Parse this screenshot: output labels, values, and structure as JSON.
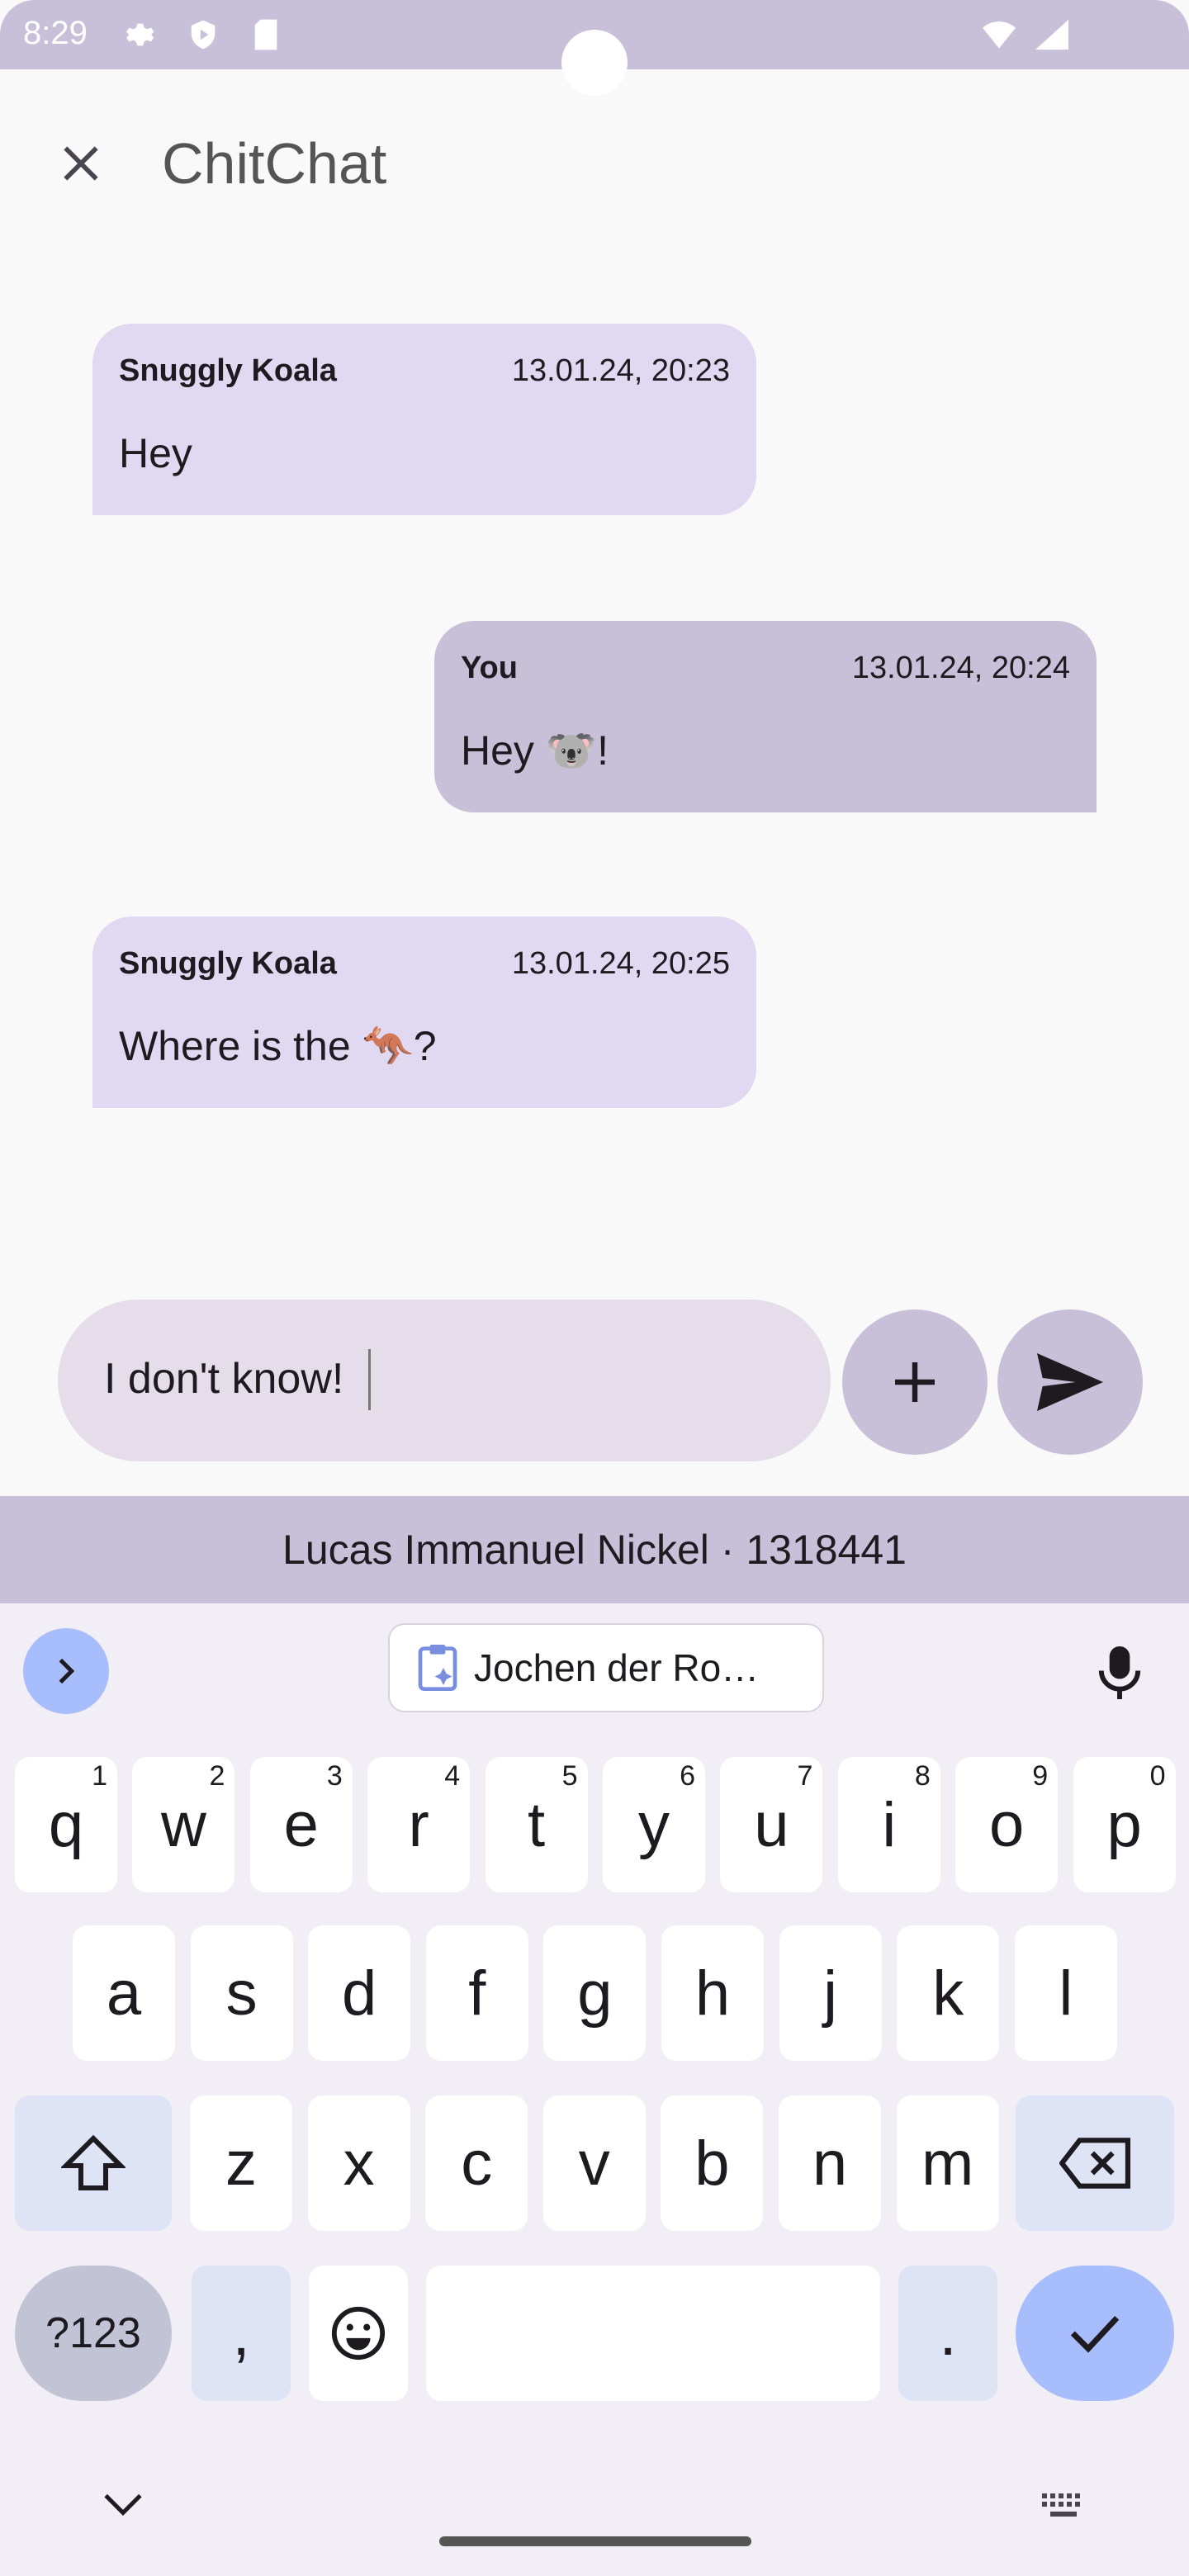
{
  "status_bar": {
    "time": "8:29",
    "icons": [
      "gear-icon",
      "shield-icon",
      "sd-card-icon",
      "wifi-icon",
      "signal-icon"
    ]
  },
  "app_bar": {
    "title": "ChitChat",
    "close_icon": "close-icon"
  },
  "messages": [
    {
      "sender": "Snuggly Koala",
      "timestamp": "13.01.24, 20:23",
      "text": "Hey",
      "outgoing": false
    },
    {
      "sender": "You",
      "timestamp": "13.01.24, 20:24",
      "text": "Hey 🐨!",
      "outgoing": true
    },
    {
      "sender": "Snuggly Koala",
      "timestamp": "13.01.24, 20:25",
      "text": "Where is the 🦘?",
      "outgoing": false
    }
  ],
  "compose": {
    "value": "I don't know!",
    "add_icon": "plus-icon",
    "send_icon": "send-icon"
  },
  "watermark": "Lucas Immanuel Nickel · 1318441",
  "keyboard": {
    "suggestion": "Jochen der Ro…",
    "row1": [
      [
        "q",
        "1"
      ],
      [
        "w",
        "2"
      ],
      [
        "e",
        "3"
      ],
      [
        "r",
        "4"
      ],
      [
        "t",
        "5"
      ],
      [
        "y",
        "6"
      ],
      [
        "u",
        "7"
      ],
      [
        "i",
        "8"
      ],
      [
        "o",
        "9"
      ],
      [
        "p",
        "0"
      ]
    ],
    "row2": [
      "a",
      "s",
      "d",
      "f",
      "g",
      "h",
      "j",
      "k",
      "l"
    ],
    "row3": [
      "z",
      "x",
      "c",
      "v",
      "b",
      "n",
      "m"
    ],
    "symbols_label": "?123",
    "comma": ",",
    "period": "."
  },
  "colors": {
    "accent": "#c8c0d8",
    "bubble_incoming": "#e1d8f1",
    "keyboard_action": "#a8bdfb"
  }
}
